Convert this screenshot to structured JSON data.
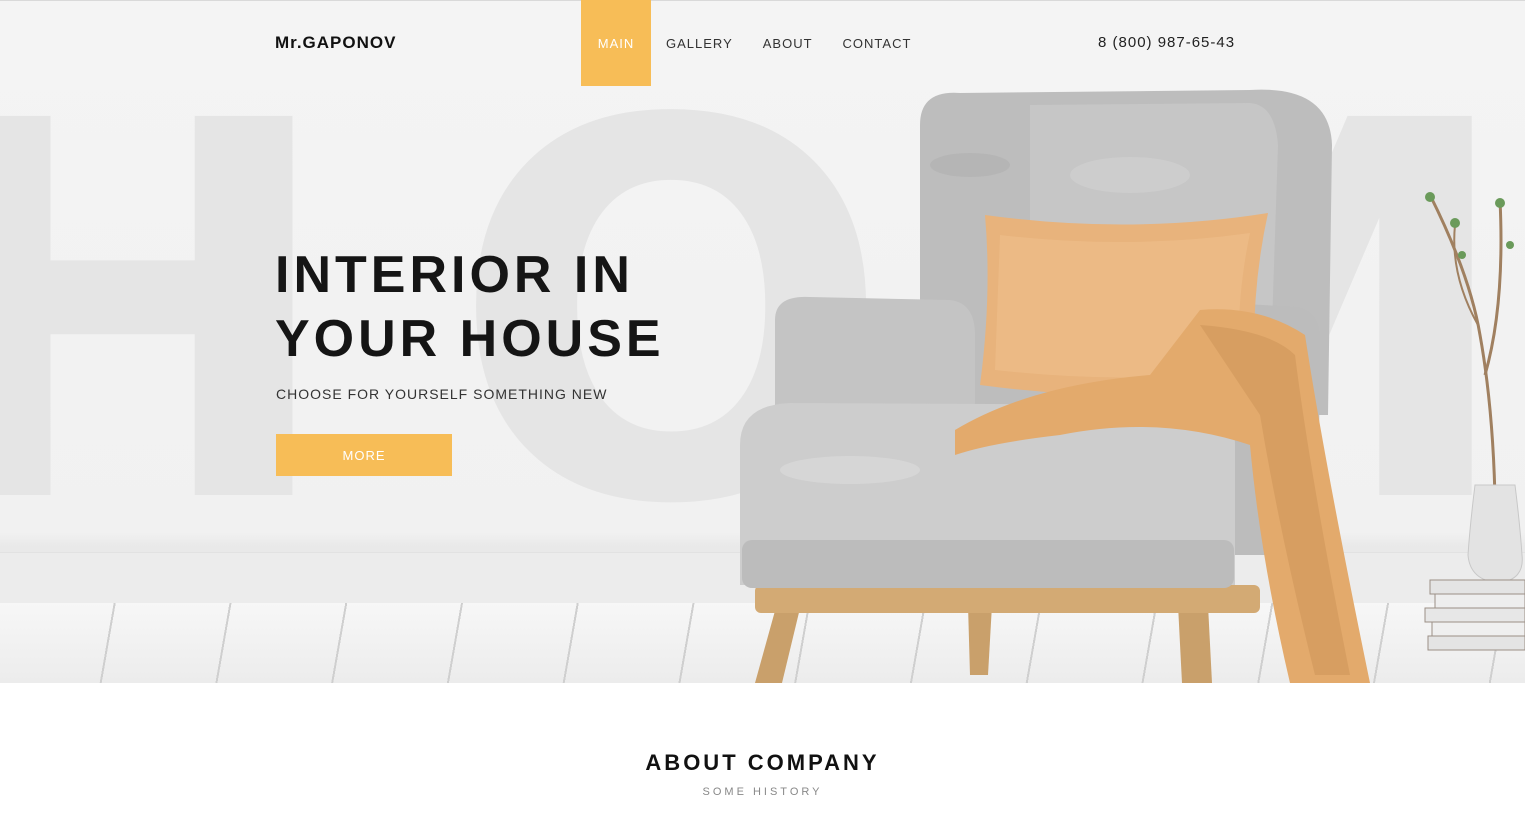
{
  "brand": {
    "logo": "Mr.GAPONOV",
    "accent_color": "#f7bd57"
  },
  "nav": {
    "items": [
      {
        "label": "MAIN",
        "active": true
      },
      {
        "label": "GALLERY",
        "active": false
      },
      {
        "label": "ABOUT",
        "active": false
      },
      {
        "label": "CONTACT",
        "active": false
      }
    ]
  },
  "header": {
    "phone": "8 (800) 987-65-43"
  },
  "hero": {
    "background_word": "HOME",
    "headline_line1": "INTERIOR IN",
    "headline_line2": "YOUR HOUSE",
    "subtitle": "CHOOSE FOR YOURSELF SOMETHING NEW",
    "button_label": "MORE"
  },
  "about": {
    "title": "ABOUT COMPANY",
    "subtitle": "SOME HISTORY"
  }
}
